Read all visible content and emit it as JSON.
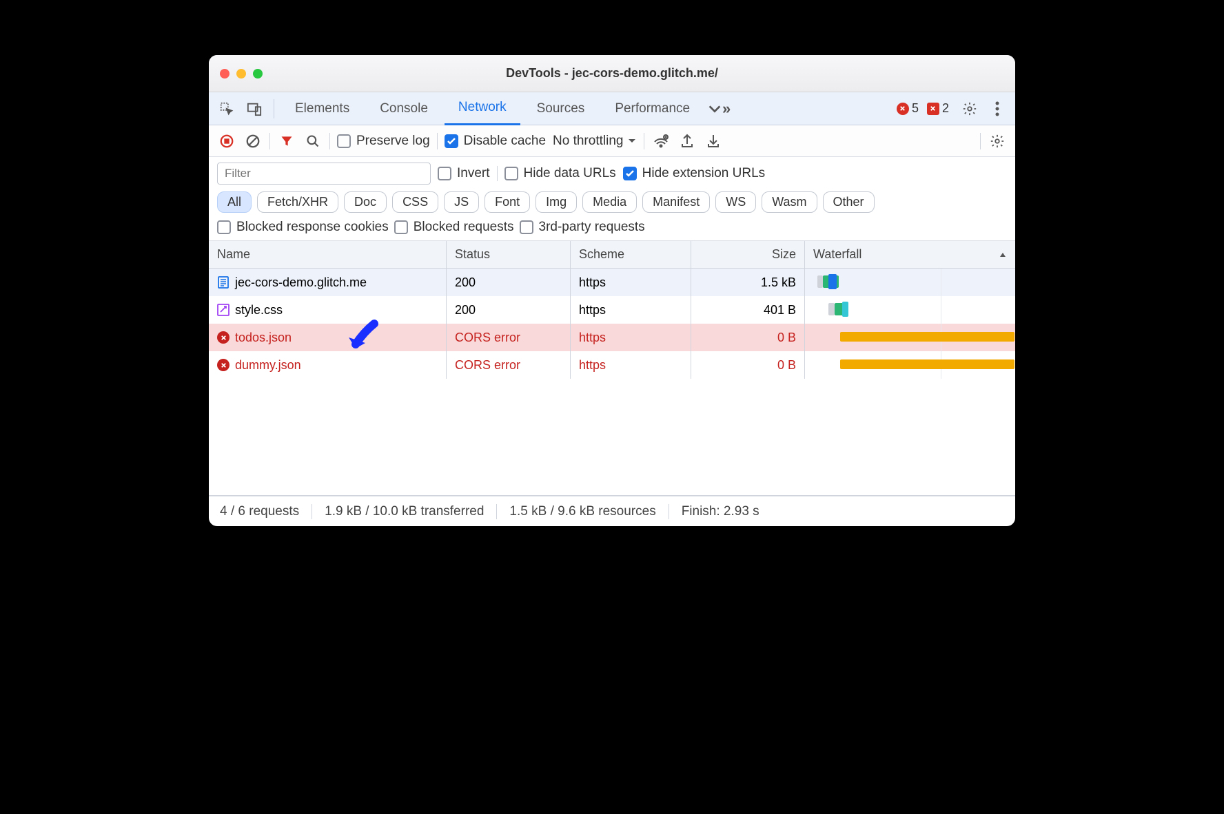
{
  "window_title": "DevTools - jec-cors-demo.glitch.me/",
  "tabs": {
    "elements": "Elements",
    "console": "Console",
    "network": "Network",
    "sources": "Sources",
    "performance": "Performance"
  },
  "active_tab": "network",
  "error_count": "5",
  "warning_count": "2",
  "toolbar": {
    "preserve_log": "Preserve log",
    "disable_cache": "Disable cache",
    "throttling": "No throttling"
  },
  "filter": {
    "placeholder": "Filter",
    "invert": "Invert",
    "hide_data_urls": "Hide data URLs",
    "hide_extension_urls": "Hide extension URLs",
    "chips": [
      "All",
      "Fetch/XHR",
      "Doc",
      "CSS",
      "JS",
      "Font",
      "Img",
      "Media",
      "Manifest",
      "WS",
      "Wasm",
      "Other"
    ],
    "blocked_response_cookies": "Blocked response cookies",
    "blocked_requests": "Blocked requests",
    "third_party": "3rd-party requests"
  },
  "columns": {
    "name": "Name",
    "status": "Status",
    "scheme": "Scheme",
    "size": "Size",
    "waterfall": "Waterfall"
  },
  "rows": [
    {
      "name": "jec-cors-demo.glitch.me",
      "status": "200",
      "scheme": "https",
      "size": "1.5 kB",
      "icon": "document",
      "error": false
    },
    {
      "name": "style.css",
      "status": "200",
      "scheme": "https",
      "size": "401 B",
      "icon": "css",
      "error": false
    },
    {
      "name": "todos.json",
      "status": "CORS error",
      "scheme": "https",
      "size": "0 B",
      "icon": "error",
      "error": true,
      "highlighted": true
    },
    {
      "name": "dummy.json",
      "status": "CORS error",
      "scheme": "https",
      "size": "0 B",
      "icon": "error",
      "error": true
    }
  ],
  "status_bar": {
    "requests": "4 / 6 requests",
    "transferred": "1.9 kB / 10.0 kB transferred",
    "resources": "1.5 kB / 9.6 kB resources",
    "finish": "Finish: 2.93 s"
  }
}
